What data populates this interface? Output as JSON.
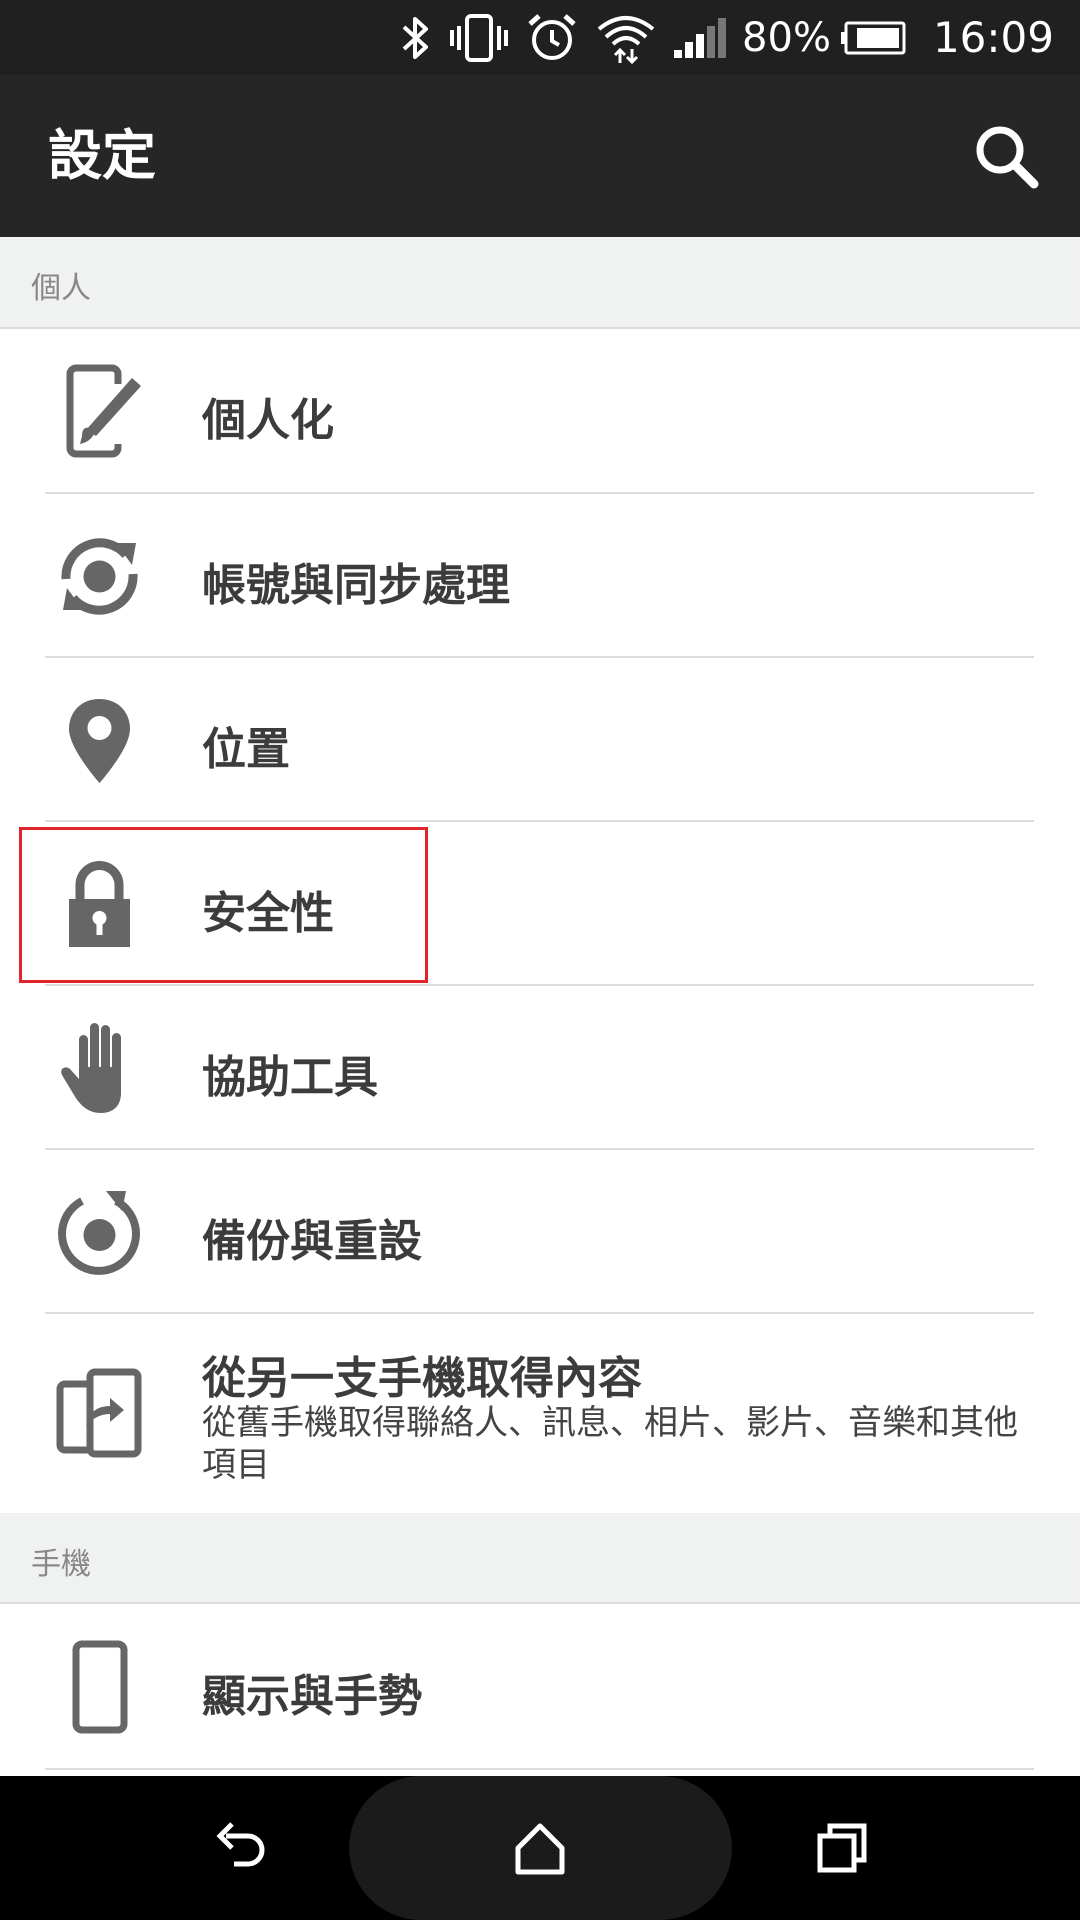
{
  "status_bar": {
    "icons": [
      "bluetooth-icon",
      "vibrate-icon",
      "alarm-icon",
      "wifi-icon",
      "signal-icon",
      "battery-icon"
    ],
    "battery_percent": "80%",
    "time": "16:09"
  },
  "app_bar": {
    "title": "設定",
    "search_icon": "search-icon"
  },
  "sections": {
    "personal": "個人",
    "phone": "手機"
  },
  "items": {
    "personalization": "個人化",
    "accounts_sync": "帳號與同步處理",
    "location": "位置",
    "security": "安全性",
    "accessibility": "協助工具",
    "backup_reset": "備份與重設",
    "transfer": "從另一支手機取得內容",
    "transfer_sub": "從舊手機取得聯絡人、訊息、相片、影片、音樂和其他項目",
    "display_gestures": "顯示與手勢"
  },
  "nav_bar": {
    "icons": [
      "back-icon",
      "home-icon",
      "recents-icon"
    ]
  },
  "colors": {
    "status_bar_bg": "#202020",
    "app_bar_bg": "#262626",
    "section_bg": "#f0f1f1",
    "icon_gray": "#666666",
    "highlight": "#e0242c"
  }
}
